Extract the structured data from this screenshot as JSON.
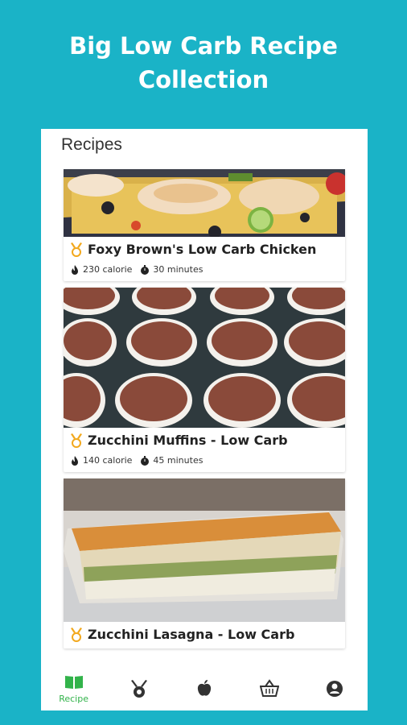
{
  "headline": {
    "line1": "Big Low Carb Recipe",
    "line2": "Collection"
  },
  "screen": {
    "title": "Recipes"
  },
  "recipes": [
    {
      "title": "Foxy Brown's Low Carb Chicken",
      "calories": "230 calorie",
      "time": "30 minutes",
      "image": "baked-chicken-vegetables-photo"
    },
    {
      "title": "Zucchini Muffins - Low Carb",
      "calories": "140 calorie",
      "time": "45 minutes",
      "image": "chocolate-muffins-tray-photo"
    },
    {
      "title": "Zucchini Lasagna - Low Carb",
      "calories": "",
      "time": "",
      "image": "lasagna-glass-dish-photo"
    }
  ],
  "nav": {
    "items": [
      {
        "label": "Recipe",
        "icon": "book-icon",
        "active": true
      },
      {
        "label": "",
        "icon": "medal-icon",
        "active": false
      },
      {
        "label": "",
        "icon": "apple-icon",
        "active": false
      },
      {
        "label": "",
        "icon": "basket-icon",
        "active": false
      },
      {
        "label": "",
        "icon": "user-icon",
        "active": false
      }
    ]
  },
  "colors": {
    "background": "#1ab3c7",
    "accent": "#32b34a",
    "medal": "#f2a81d"
  }
}
